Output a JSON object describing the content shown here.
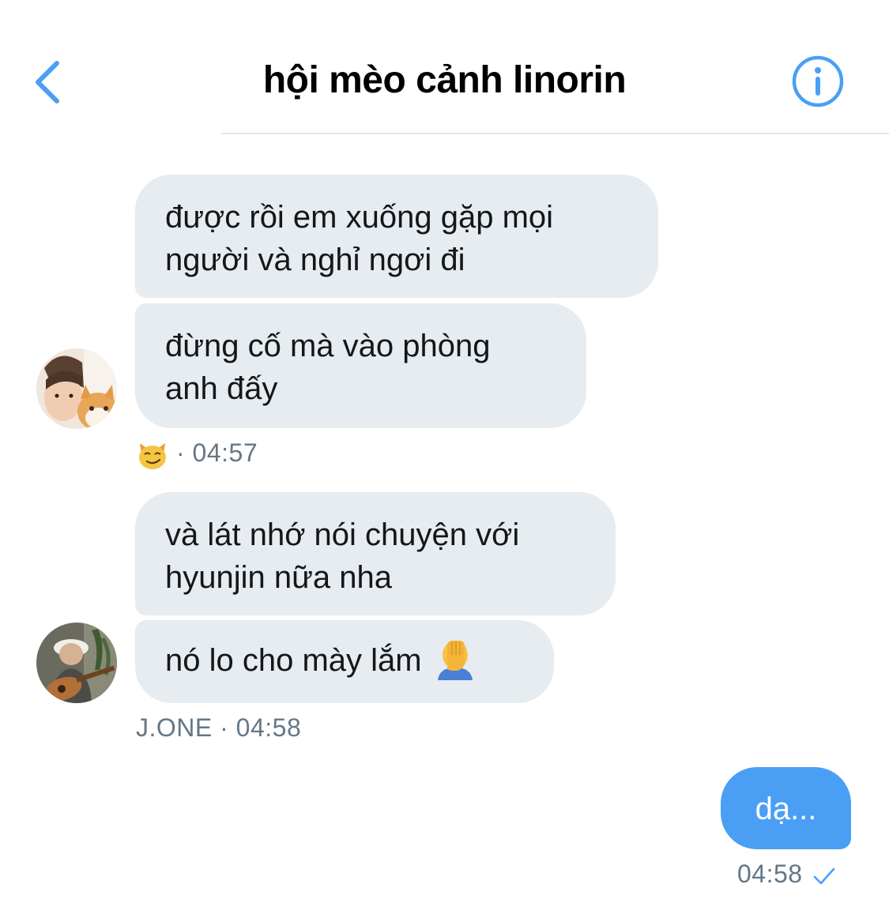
{
  "header": {
    "title": "hội mèo cảnh linorin",
    "back_icon": "chevron-left-icon",
    "info_icon": "info-icon",
    "accent_color": "#4a9ff5"
  },
  "messages": [
    {
      "group": "sender-1",
      "bubbles": [
        "được rồi em xuống gặp mọi\nngười và nghỉ ngơi đi",
        "đừng cố mà vào phòng\nanh đấy"
      ],
      "reaction_icon": "smirking-cat-icon",
      "meta_text": "· 04:57"
    },
    {
      "group": "sender-2",
      "bubbles": [
        "và lát nhớ nói chuyện với\nhyunjin nữa nha",
        "nó lo cho mày lắm"
      ],
      "inline_emoji": "facepalm-icon",
      "meta_text": "J.ONE · 04:58"
    },
    {
      "group": "self",
      "bubbles": [
        "dạ..."
      ],
      "meta_text": "04:58",
      "status_icon": "sent-check-icon"
    }
  ],
  "colors": {
    "incoming_bubble": "#e6ecf0",
    "outgoing_bubble": "#4a9ff5",
    "meta_text": "#657786"
  }
}
